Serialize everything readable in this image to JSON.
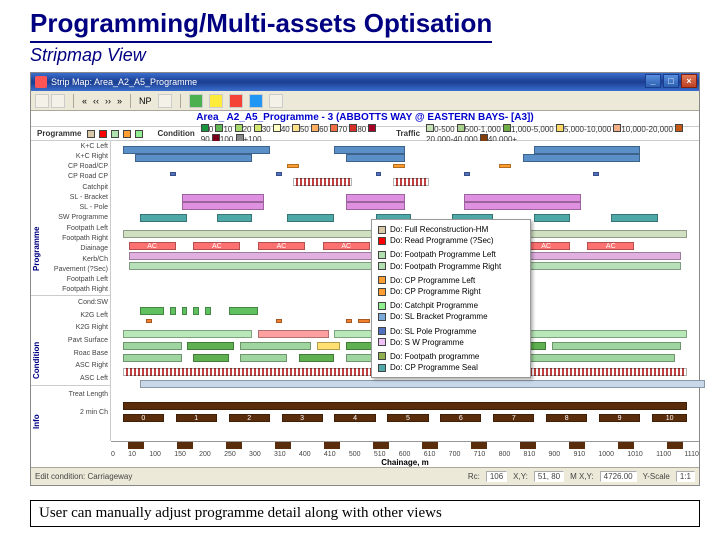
{
  "slide": {
    "title": "Programming/Multi-assets Optisation",
    "subtitle": "Stripmap View",
    "caption": "User can manually adjust programme detail along with other views"
  },
  "window": {
    "title": "Strip Map: Area_A2_A5_Programme",
    "chart_title": "Area_ A2_A5_Programme - 3 (ABBOTTS WAY @ EASTERN BAYS- [A3])"
  },
  "legend": {
    "programme_label": "Programme",
    "condition_label": "Condition",
    "traffic_label": "Traffic",
    "condition_items": [
      "0",
      "10",
      "20",
      "30",
      "40",
      "50",
      "60",
      "70",
      "80",
      "90",
      "100",
      "+100"
    ],
    "traffic_items": [
      "0-500",
      "500-1,000",
      "1,000-5,000",
      "5,000-10,000",
      "10,000-20,000",
      "20,000-40,000",
      "40,000+"
    ]
  },
  "ylabels": {
    "group1": "Programme",
    "group2": "Condition",
    "group3": "Info",
    "rows_prog": [
      "K+C Left",
      "K+C Right",
      "CP Road/CP",
      "CP Road CP",
      "Catchpit",
      "SL - Bracket",
      "SL - Pole",
      "SW Programme",
      "Footpath Left",
      "Footpath Right",
      "Diainage",
      "Kerb/Ch",
      "Pavement (?Sec)",
      "Footpath Left",
      "Footpath Right"
    ],
    "rows_cond": [
      "Cond:SW",
      "K2G Left",
      "K2G Right",
      "Pavt Surface",
      "Roac Base",
      "ASC Right",
      "ASC Left"
    ],
    "rows_info": [
      "Treat Length",
      "2 min Ch"
    ]
  },
  "popup": {
    "items": [
      {
        "color": "#d8c8a8",
        "text": "Do: Full Reconstruction-HM"
      },
      {
        "color": "#ff0000",
        "text": "Do: Read Programme (?Sec)"
      },
      {
        "sep": true
      },
      {
        "color": "#b0e0b0",
        "text": "Do: Footpath Programme Left"
      },
      {
        "color": "#b0e0b0",
        "text": "Do: Footpath Programme Right"
      },
      {
        "sep": true
      },
      {
        "color": "#ff9d30",
        "text": "Do: CP Programme Left"
      },
      {
        "color": "#ff9d30",
        "text": "Do: CP Programme Right"
      },
      {
        "sep": true
      },
      {
        "color": "#90f090",
        "text": "Do: Catchpit Programme"
      },
      {
        "color": "#7aa8d8",
        "text": "Do: SL Bracket Programme"
      },
      {
        "sep": true
      },
      {
        "color": "#5070c0",
        "text": "Do: SL Pole Programme"
      },
      {
        "color": "#f0c0f8",
        "text": "Do: S W Programme"
      },
      {
        "sep": true
      },
      {
        "color": "#90b050",
        "text": "Do: Footpath programme"
      },
      {
        "color": "#4fa8a8",
        "text": "Do: CP Programme Seal"
      }
    ]
  },
  "xaxis": {
    "ticks": [
      "0",
      "10",
      "100",
      "150",
      "200",
      "250",
      "300",
      "310",
      "400",
      "410",
      "500",
      "510",
      "600",
      "610",
      "700",
      "710",
      "800",
      "810",
      "900",
      "910",
      "1000",
      "1010",
      "1100",
      "1110"
    ],
    "label": "Chainage, m"
  },
  "status": {
    "left": "Edit condition: Carriageway",
    "rc": "Rc:",
    "rc_val": "106",
    "xy": "X,Y:",
    "xy_val": "51, 80",
    "mxy": "M X,Y:",
    "mxy_val": "4726.00",
    "yscale": "Y-Scale",
    "yscale_val": "1:1"
  }
}
